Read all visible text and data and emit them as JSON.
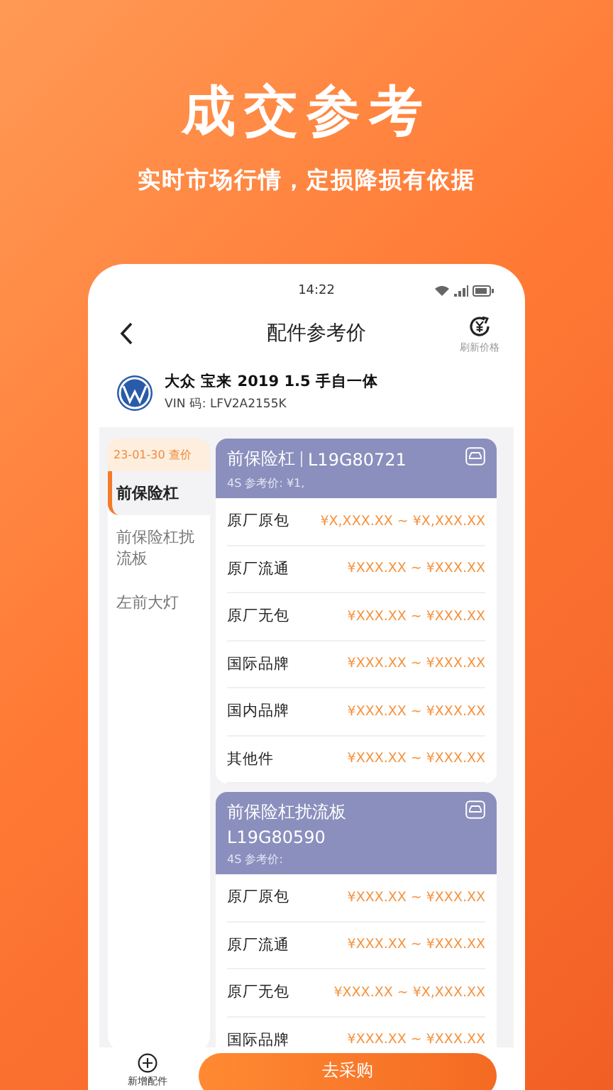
{
  "promo": {
    "headline": "成交参考",
    "subline": "实时市场行情，定损降损有依据"
  },
  "status_bar": {
    "time": "14:22"
  },
  "header": {
    "title": "配件参考价",
    "refresh_label": "刷新价格"
  },
  "vehicle": {
    "name": "大众 宝来 2019  1.5 手自一体",
    "vin": "VIN 码: LFV2A2155K"
  },
  "sidebar": {
    "date_chip": "23-01-30 查价",
    "items": [
      {
        "label": "前保险杠",
        "selected": true
      },
      {
        "label": "前保险杠扰流板",
        "selected": false
      },
      {
        "label": "左前大灯",
        "selected": false
      }
    ]
  },
  "parts": [
    {
      "name": "前保险杠",
      "code": "L19G80721",
      "inline_code": true,
      "reference": "4S 参考价: ¥1,",
      "rows": [
        {
          "label": "原厂原包",
          "price": "¥X,XXX.XX ~ ¥X,XXX.XX"
        },
        {
          "label": "原厂流通",
          "price": "¥XXX.XX ~ ¥XXX.XX"
        },
        {
          "label": "原厂无包",
          "price": "¥XXX.XX ~ ¥XXX.XX"
        },
        {
          "label": "国际品牌",
          "price": "¥XXX.XX ~ ¥XXX.XX"
        },
        {
          "label": "国内品牌",
          "price": "¥XXX.XX ~ ¥XXX.XX"
        },
        {
          "label": "其他件",
          "price": "¥XXX.XX ~ ¥XXX.XX"
        }
      ]
    },
    {
      "name": "前保险杠扰流板",
      "code": "L19G80590",
      "inline_code": false,
      "reference": "4S 参考价:",
      "rows": [
        {
          "label": "原厂原包",
          "price": "¥XXX.XX ~ ¥XXX.XX"
        },
        {
          "label": "原厂流通",
          "price": "¥XXX.XX ~ ¥XXX.XX"
        },
        {
          "label": "原厂无包",
          "price": "¥XXX.XX ~ ¥X,XXX.XX"
        },
        {
          "label": "国际品牌",
          "price": "¥XXX.XX ~ ¥XXX.XX"
        }
      ]
    }
  ],
  "bottom_bar": {
    "add_label": "新增配件",
    "action_label": "去采购"
  }
}
